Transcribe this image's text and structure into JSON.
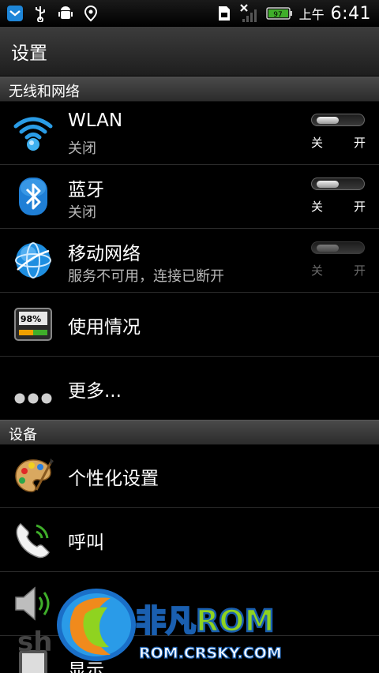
{
  "statusbar": {
    "icons_left": [
      "message-app-icon",
      "usb-icon",
      "android-debug-icon",
      "location-icon"
    ],
    "icons_right": [
      "sim-icon",
      "no-signal-icon",
      "battery-icon"
    ],
    "battery_level": "97",
    "ampm": "上午",
    "time": "6:41"
  },
  "header": {
    "title": "设置"
  },
  "sections": [
    {
      "title": "无线和网络"
    },
    {
      "title": "设备"
    }
  ],
  "items": [
    {
      "label": "WLAN",
      "sub": "关闭",
      "toggle": {
        "off": "关",
        "on": "开",
        "state": "off",
        "enabled": true
      }
    },
    {
      "label": "蓝牙",
      "sub": "关闭",
      "toggle": {
        "off": "关",
        "on": "开",
        "state": "off",
        "enabled": true
      }
    },
    {
      "label": "移动网络",
      "sub": "服务不可用，连接已断开",
      "toggle": {
        "off": "关",
        "on": "开",
        "state": "off",
        "enabled": false
      }
    },
    {
      "label": "使用情况",
      "meter_text": "98%"
    },
    {
      "label": "更多..."
    },
    {
      "label": "个性化设置"
    },
    {
      "label": "呼叫"
    },
    {
      "label": "声"
    },
    {
      "label": "显示"
    }
  ],
  "watermark": {
    "brand": "非凡ROM",
    "url": "ROM.CRSKY.COM",
    "faint": "sh"
  },
  "colors": {
    "accent_blue": "#2a8fd8",
    "watermark_green": "#8fd320",
    "watermark_orange": "#f08a1c"
  }
}
